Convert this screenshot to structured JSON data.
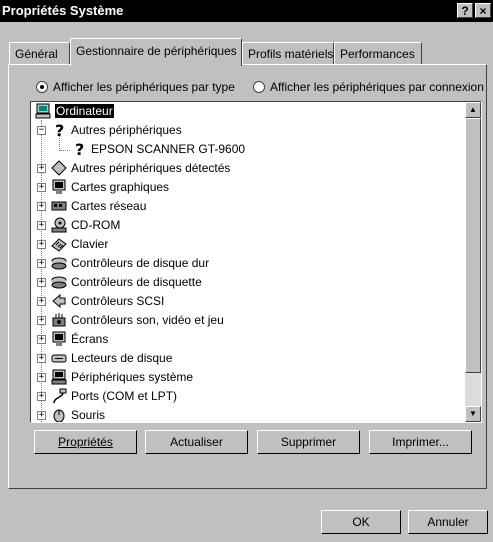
{
  "window": {
    "title": "Propriétés Système",
    "help_label": "?",
    "close_label": "×"
  },
  "tabs": [
    {
      "label": "Général"
    },
    {
      "label": "Gestionnaire de périphériques"
    },
    {
      "label": "Profils matériels"
    },
    {
      "label": "Performances"
    }
  ],
  "view_options": {
    "by_type": {
      "label": "Afficher les périphériques par type",
      "selected": true
    },
    "by_connection": {
      "label": "Afficher les périphériques par connexion",
      "selected": false
    }
  },
  "tree": {
    "root": "Ordinateur",
    "items": [
      {
        "label": "Autres périphériques",
        "icon": "question-icon",
        "expander": "−"
      },
      {
        "label": "EPSON SCANNER GT-9600",
        "icon": "question-icon"
      },
      {
        "label": "Autres périphériques détectés",
        "icon": "diamond-icon",
        "expander": "+"
      },
      {
        "label": "Cartes graphiques",
        "icon": "monitor-icon",
        "expander": "+"
      },
      {
        "label": "Cartes réseau",
        "icon": "network-card-icon",
        "expander": "+"
      },
      {
        "label": "CD-ROM",
        "icon": "cdrom-icon",
        "expander": "+"
      },
      {
        "label": "Clavier",
        "icon": "keyboard-icon",
        "expander": "+"
      },
      {
        "label": "Contrôleurs de disque dur",
        "icon": "hard-disk-icon",
        "expander": "+"
      },
      {
        "label": "Contrôleurs de disquette",
        "icon": "floppy-controller-icon",
        "expander": "+"
      },
      {
        "label": "Contrôleurs SCSI",
        "icon": "scsi-icon",
        "expander": "+"
      },
      {
        "label": "Contrôleurs son, vidéo et jeu",
        "icon": "sound-icon",
        "expander": "+"
      },
      {
        "label": "Écrans",
        "icon": "monitor-icon",
        "expander": "+"
      },
      {
        "label": "Lecteurs de disque",
        "icon": "disk-drive-icon",
        "expander": "+"
      },
      {
        "label": "Périphériques système",
        "icon": "computer-icon",
        "expander": "+"
      },
      {
        "label": "Ports (COM et LPT)",
        "icon": "port-icon",
        "expander": "+"
      },
      {
        "label": "Souris",
        "icon": "mouse-icon",
        "expander": "+"
      }
    ]
  },
  "buttons": {
    "properties": "Propriétés",
    "refresh": "Actualiser",
    "remove": "Supprimer",
    "print": "Imprimer...",
    "ok": "OK",
    "cancel": "Annuler"
  },
  "colors": {
    "face": "#c0c0c0",
    "titlebar": "#000000",
    "selection": "#000000"
  }
}
